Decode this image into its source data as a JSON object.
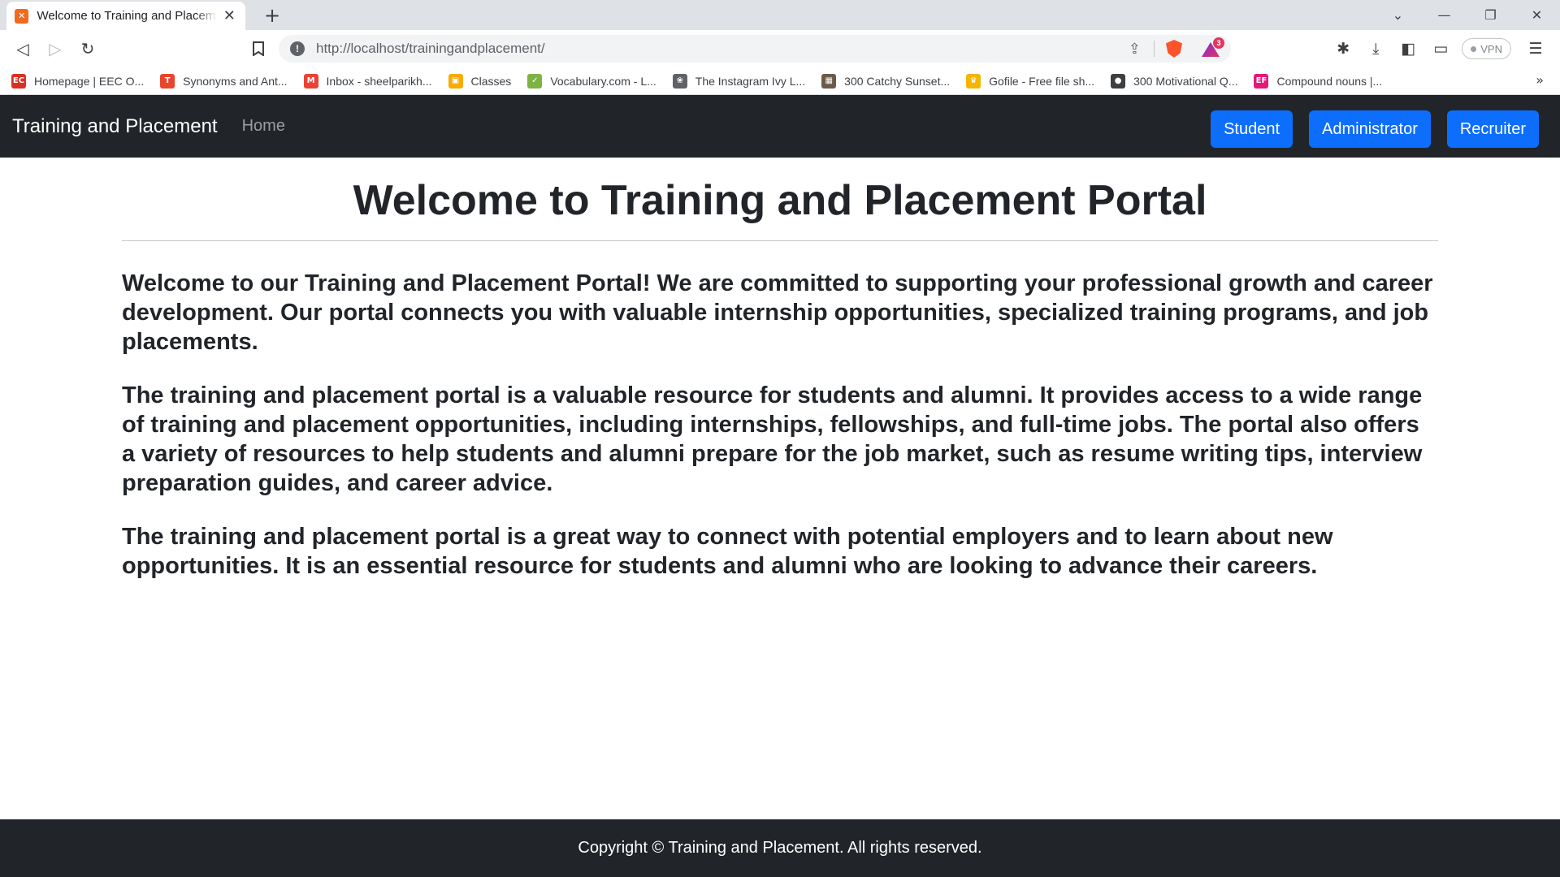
{
  "browser": {
    "tab": {
      "title": "Welcome to Training and Placement",
      "favicon": "xampp-icon",
      "close_glyph": "✕"
    },
    "new_tab_glyph": "+",
    "window_controls": {
      "tablist_glyph": "⌄",
      "minimize_glyph": "—",
      "restore_glyph": "❐",
      "close_glyph": "✕"
    },
    "toolbar": {
      "back_glyph": "◁",
      "forward_glyph": "▷",
      "reload_glyph": "↻",
      "url": "http://localhost/trainingandplacement/",
      "rewards_badge": "3",
      "vpn_label": "VPN"
    },
    "bookmarks": [
      {
        "label": "Homepage | EEC O...",
        "icon": "eec-icon",
        "color": "#d93025",
        "glyph": "EC"
      },
      {
        "label": "Synonyms and Ant...",
        "icon": "thesaurus-icon",
        "color": "#e8452c",
        "glyph": "T"
      },
      {
        "label": "Inbox - sheelparikh...",
        "icon": "gmail-icon",
        "color": "#ea4335",
        "glyph": "M"
      },
      {
        "label": "Classes",
        "icon": "classroom-icon",
        "color": "#f9ab00",
        "glyph": "▣"
      },
      {
        "label": "Vocabulary.com - L...",
        "icon": "vocabulary-icon",
        "color": "#7cb342",
        "glyph": "✓"
      },
      {
        "label": "The Instagram Ivy L...",
        "icon": "instagram-ivy-icon",
        "color": "#5f6368",
        "glyph": "❀"
      },
      {
        "label": "300 Catchy Sunset...",
        "icon": "sunset-icon",
        "color": "#6d5a4a",
        "glyph": "▦"
      },
      {
        "label": "Gofile - Free file sh...",
        "icon": "gofile-icon",
        "color": "#f5b400",
        "glyph": "♛"
      },
      {
        "label": "300 Motivational Q...",
        "icon": "globe-icon",
        "color": "#3c4043",
        "glyph": "●"
      },
      {
        "label": "Compound nouns |...",
        "icon": "ef-icon",
        "color": "#e5187a",
        "glyph": "EF"
      }
    ],
    "bookmarks_more_glyph": "»"
  },
  "site": {
    "brand": "Training and Placement",
    "nav_home": "Home",
    "buttons": {
      "student": "Student",
      "administrator": "Administrator",
      "recruiter": "Recruiter"
    },
    "title": "Welcome to Training and Placement Portal",
    "paragraphs": [
      "Welcome to our Training and Placement Portal! We are committed to supporting your professional growth and career development. Our portal connects you with valuable internship opportunities, specialized training programs, and job placements.",
      "The training and placement portal is a valuable resource for students and alumni. It provides access to a wide range of training and placement opportunities, including internships, fellowships, and full-time jobs. The portal also offers a variety of resources to help students and alumni prepare for the job market, such as resume writing tips, interview preparation guides, and career advice.",
      "The training and placement portal is a great way to connect with potential employers and to learn about new opportunities. It is an essential resource for students and alumni who are looking to advance their careers."
    ],
    "footer": "Copyright © Training and Placement. All rights reserved."
  },
  "colors": {
    "navbar_bg": "#212529",
    "primary_button": "#0d6efd",
    "text": "#212529"
  }
}
